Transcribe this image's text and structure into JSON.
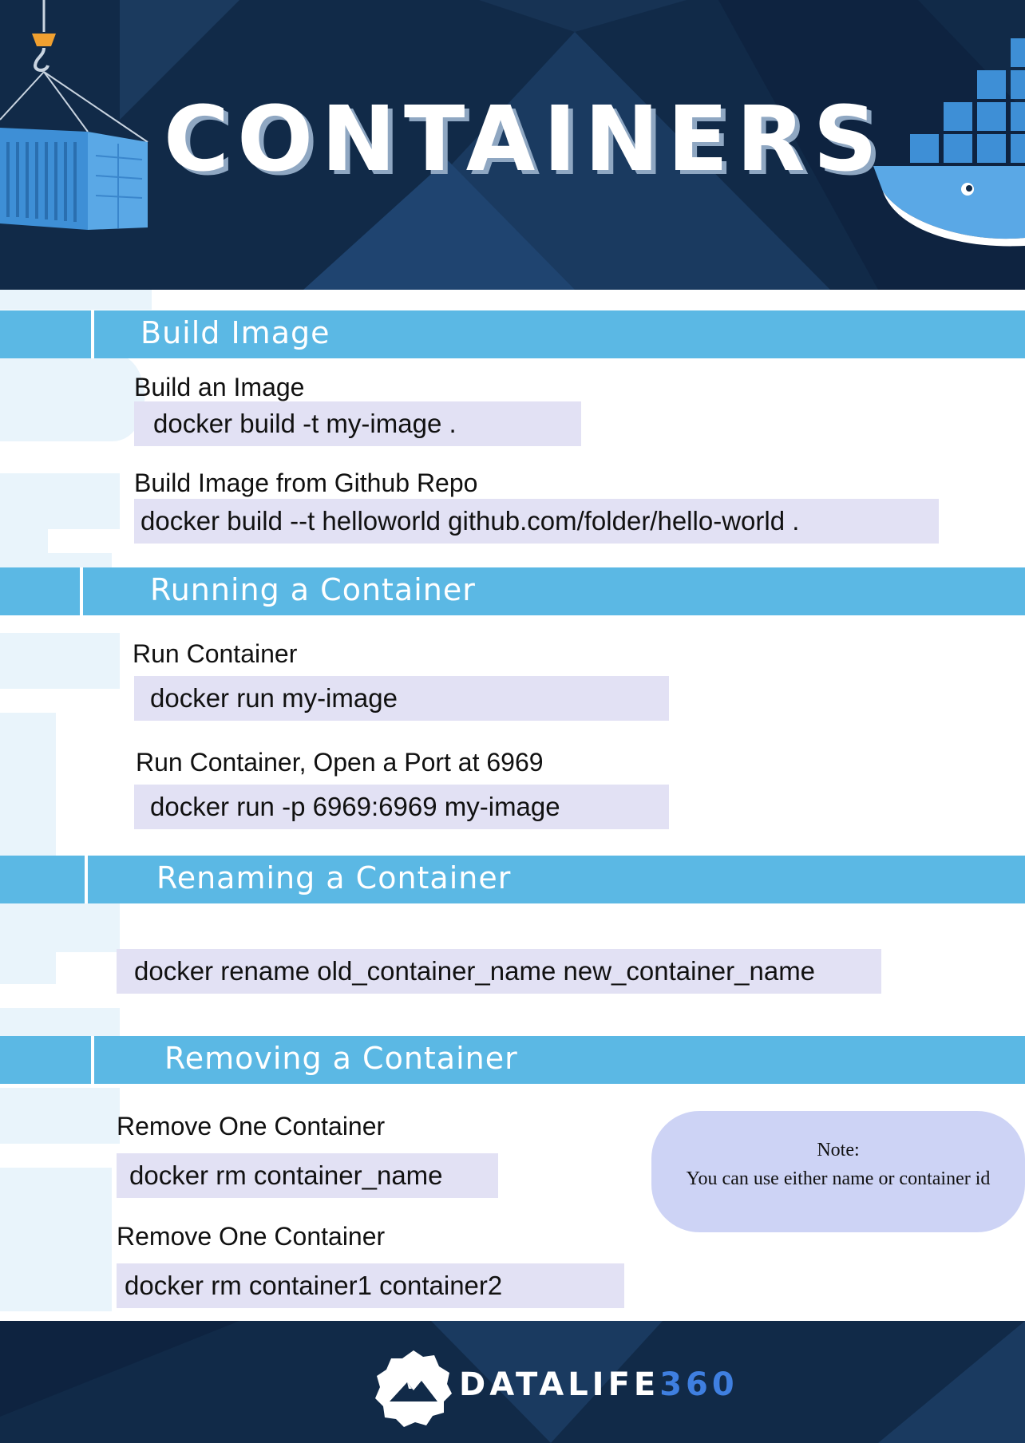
{
  "header": {
    "title": "CONTAINERS"
  },
  "sections": [
    {
      "heading": "Build Image",
      "items": [
        {
          "label": "Build an Image",
          "command": "docker build -t my-image ."
        },
        {
          "label": "Build Image from Github Repo",
          "command": "docker build --t helloworld github.com/folder/hello-world ."
        }
      ]
    },
    {
      "heading": "Running a Container",
      "items": [
        {
          "label": "Run Container",
          "command": "docker run my-image"
        },
        {
          "label": "Run Container, Open a Port at 6969",
          "command": "docker run -p 6969:6969 my-image"
        }
      ]
    },
    {
      "heading": "Renaming a Container",
      "items": [
        {
          "command": "docker rename old_container_name new_container_name"
        }
      ]
    },
    {
      "heading": "Removing a Container",
      "items": [
        {
          "label": "Remove One Container",
          "command": "docker rm container_name"
        },
        {
          "label": "Remove One Container",
          "command": "docker rm container1 container2"
        }
      ]
    }
  ],
  "note": {
    "title": "Note:",
    "text": "You can use either name or container id"
  },
  "footer": {
    "brand_main": "DATALIFE",
    "brand_accent": "360"
  },
  "colors": {
    "navy": "#112a48",
    "section_bar": "#5bb8e4",
    "command_bg": "#e2e1f4",
    "note_bg": "#cdd3f5",
    "brand_accent": "#3f7fe0"
  },
  "icons": [
    "crane-container-icon",
    "docker-whale-icon",
    "mountain-logo-icon"
  ]
}
